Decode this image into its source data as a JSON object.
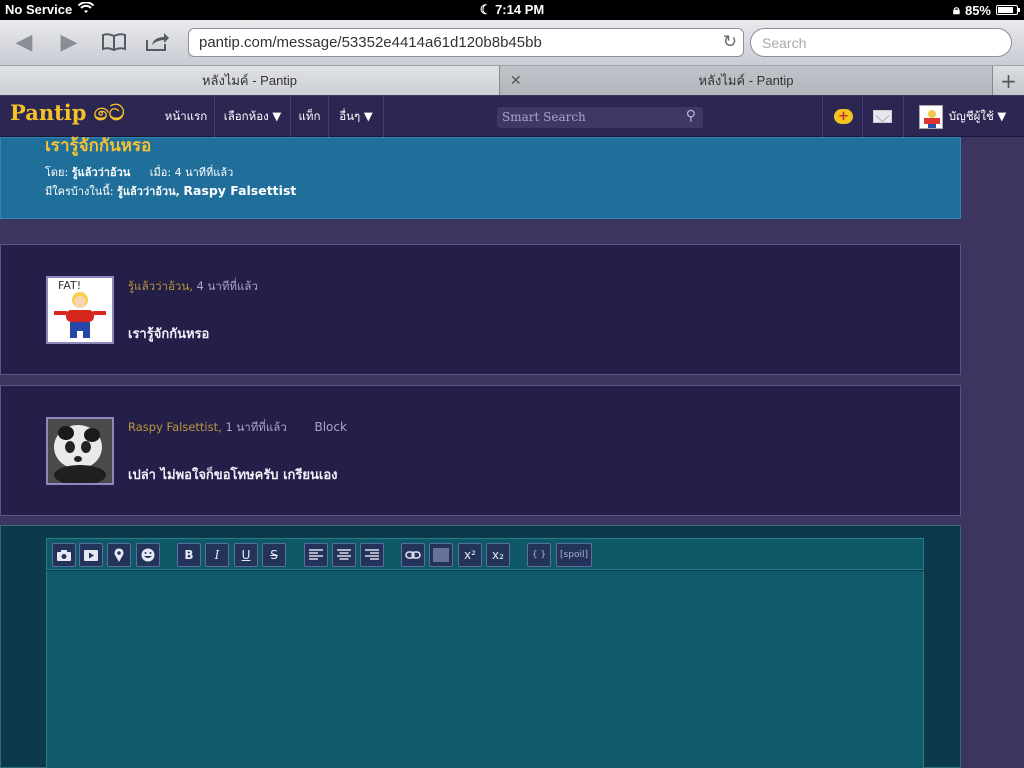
{
  "status_bar": {
    "carrier": "No Service",
    "time": "7:14 PM",
    "battery": "85%",
    "battery_fraction": 0.85
  },
  "browser": {
    "url": "pantip.com/message/53352e4414a61d120b8b45bb",
    "search_placeholder": "Search",
    "tabs": [
      {
        "label": "หลังไมค์ - Pantip",
        "active": true
      },
      {
        "label": "หลังไมค์ - Pantip",
        "active": false
      }
    ]
  },
  "pantip_nav": {
    "logo": "Pantip",
    "items": [
      "หน้าแรก",
      "เลือกห้อง ▼",
      "แท็ก",
      "อื่นๆ ▼"
    ],
    "search_placeholder": "Smart Search",
    "account_label": "บัญชีผู้ใช้ ▼"
  },
  "topic": {
    "title": "เรารู้จักกันหรอ",
    "by_label": "โดย:",
    "author": "รู้แล้วว่าอ้วน",
    "when_label": "เมื่อ:",
    "when": "4 นาทีที่แล้ว",
    "participants_label": "มีใครบ้างในนี้:",
    "participant1": "รู้แล้วว่าอ้วน,",
    "participant2": "Raspy Falsettist"
  },
  "comments": [
    {
      "author": "รู้แล้วว่าอ้วน,",
      "time": "4 นาทีที่แล้ว",
      "block": "",
      "text": "เรารู้จักกันหรอ",
      "avatar_caption": "FAT!"
    },
    {
      "author": "Raspy Falsettist,",
      "time": "1 นาทีที่แล้ว",
      "block": "Block",
      "text": "เปล่า ไม่พอใจก็ขอโทษครับ เกรียนเอง",
      "avatar_caption": ""
    }
  ],
  "editor": {
    "buttons": [
      "B",
      "I",
      "U",
      "S",
      "x²",
      "x₂",
      "{ }",
      "[spoil]"
    ]
  }
}
